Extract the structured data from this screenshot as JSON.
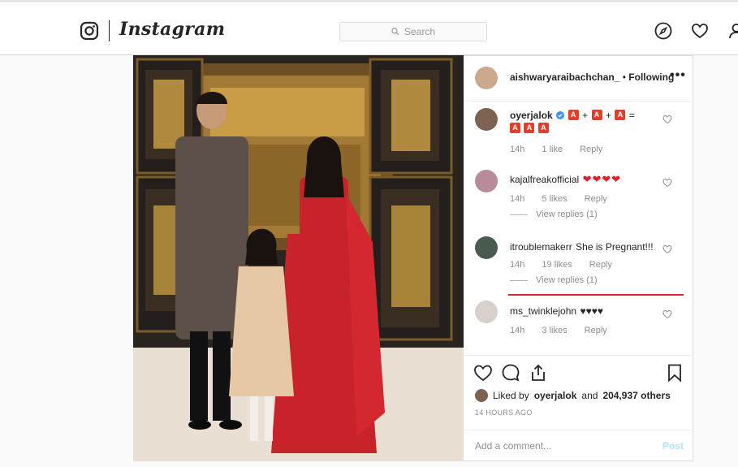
{
  "header": {
    "wordmark": "Instagram",
    "search_placeholder": "Search",
    "icons": [
      "instagram-logo-icon",
      "compass-icon",
      "heart-icon",
      "profile-icon"
    ]
  },
  "post": {
    "author": "aishwaryaraibachchan_",
    "separator": "•",
    "follow_status": "Following",
    "more_label": "•••"
  },
  "comments": [
    {
      "user": "oyerjalok",
      "verified": true,
      "text_parts": [
        "A",
        "+",
        "A",
        "+",
        "A",
        "=",
        "A",
        "A",
        "A"
      ],
      "time": "14h",
      "likes": "1 like",
      "reply": "Reply"
    },
    {
      "user": "kajalfreakofficial",
      "text": "❤❤❤❤",
      "time": "14h",
      "likes": "5 likes",
      "reply": "Reply",
      "view_replies": "View replies (1)"
    },
    {
      "user": "itroublemakerr",
      "text": "She is Pregnant!!!",
      "time": "14h",
      "likes": "19 likes",
      "reply": "Reply",
      "view_replies": "View replies (1)"
    },
    {
      "user": "ms_twinklejohn",
      "text": "♥♥♥♥",
      "time": "14h",
      "likes": "3 likes",
      "reply": "Reply"
    }
  ],
  "liked_by": {
    "prefix": "Liked by",
    "user": "oyerjalok",
    "middle": "and",
    "others": "204,937 others"
  },
  "timestamp": "14 HOURS AGO",
  "add_comment": {
    "placeholder": "Add a comment...",
    "post_label": "Post"
  },
  "colors": {
    "accent_red": "#d9232f",
    "link_blue": "#b2dffc",
    "muted": "#8e8e8e"
  }
}
